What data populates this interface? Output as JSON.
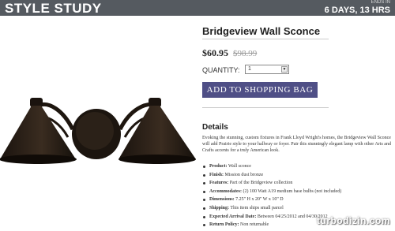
{
  "header": {
    "brand": "STYLE STUDY",
    "ends_label": "ENDS IN",
    "ends_value": "6 DAYS, 13 HRS"
  },
  "product": {
    "title": "Bridgeview Wall Sconce",
    "price": "$60.95",
    "original_price": "$98.99",
    "quantity_label": "QUANTITY:",
    "quantity_value": "1",
    "add_button": "ADD TO SHOPPING BAG",
    "image_icon": "wall-sconce-lamp"
  },
  "details": {
    "heading": "Details",
    "description": "Evoking the stunning, custom fixtures in Frank Lloyd Wright's homes, the Bridgeview Wall Sconce will add Prairie style to your hallway or foyer. Pair this stunningly elegant lamp with other Arts and Crafts accents for a truly American look.",
    "specs": [
      {
        "key": "Product:",
        "value": " Wall sconce"
      },
      {
        "key": "Finish:",
        "value": " Mission dust bronze"
      },
      {
        "key": "Features:",
        "value": " Part of the Bridgeview collection"
      },
      {
        "key": "Accommodates:",
        "value": " (2) 100 Watt A19 medium base bulbs (not included)"
      },
      {
        "key": "Dimensions:",
        "value": " 7.25\" H x 20\" W x 10\" D"
      },
      {
        "key": "Shipping:",
        "value": " This item ships small parcel"
      },
      {
        "key": "Expected Arrival Date:",
        "value": " Between 04/25/2012 and 04/30/2012"
      },
      {
        "key": "Return Policy:",
        "value": " Non returnable"
      }
    ]
  },
  "watermark": "turbodizin.com",
  "colors": {
    "topbar": "#555a60",
    "button": "#4f4f86",
    "lamp_bronze": "#2a2018"
  }
}
